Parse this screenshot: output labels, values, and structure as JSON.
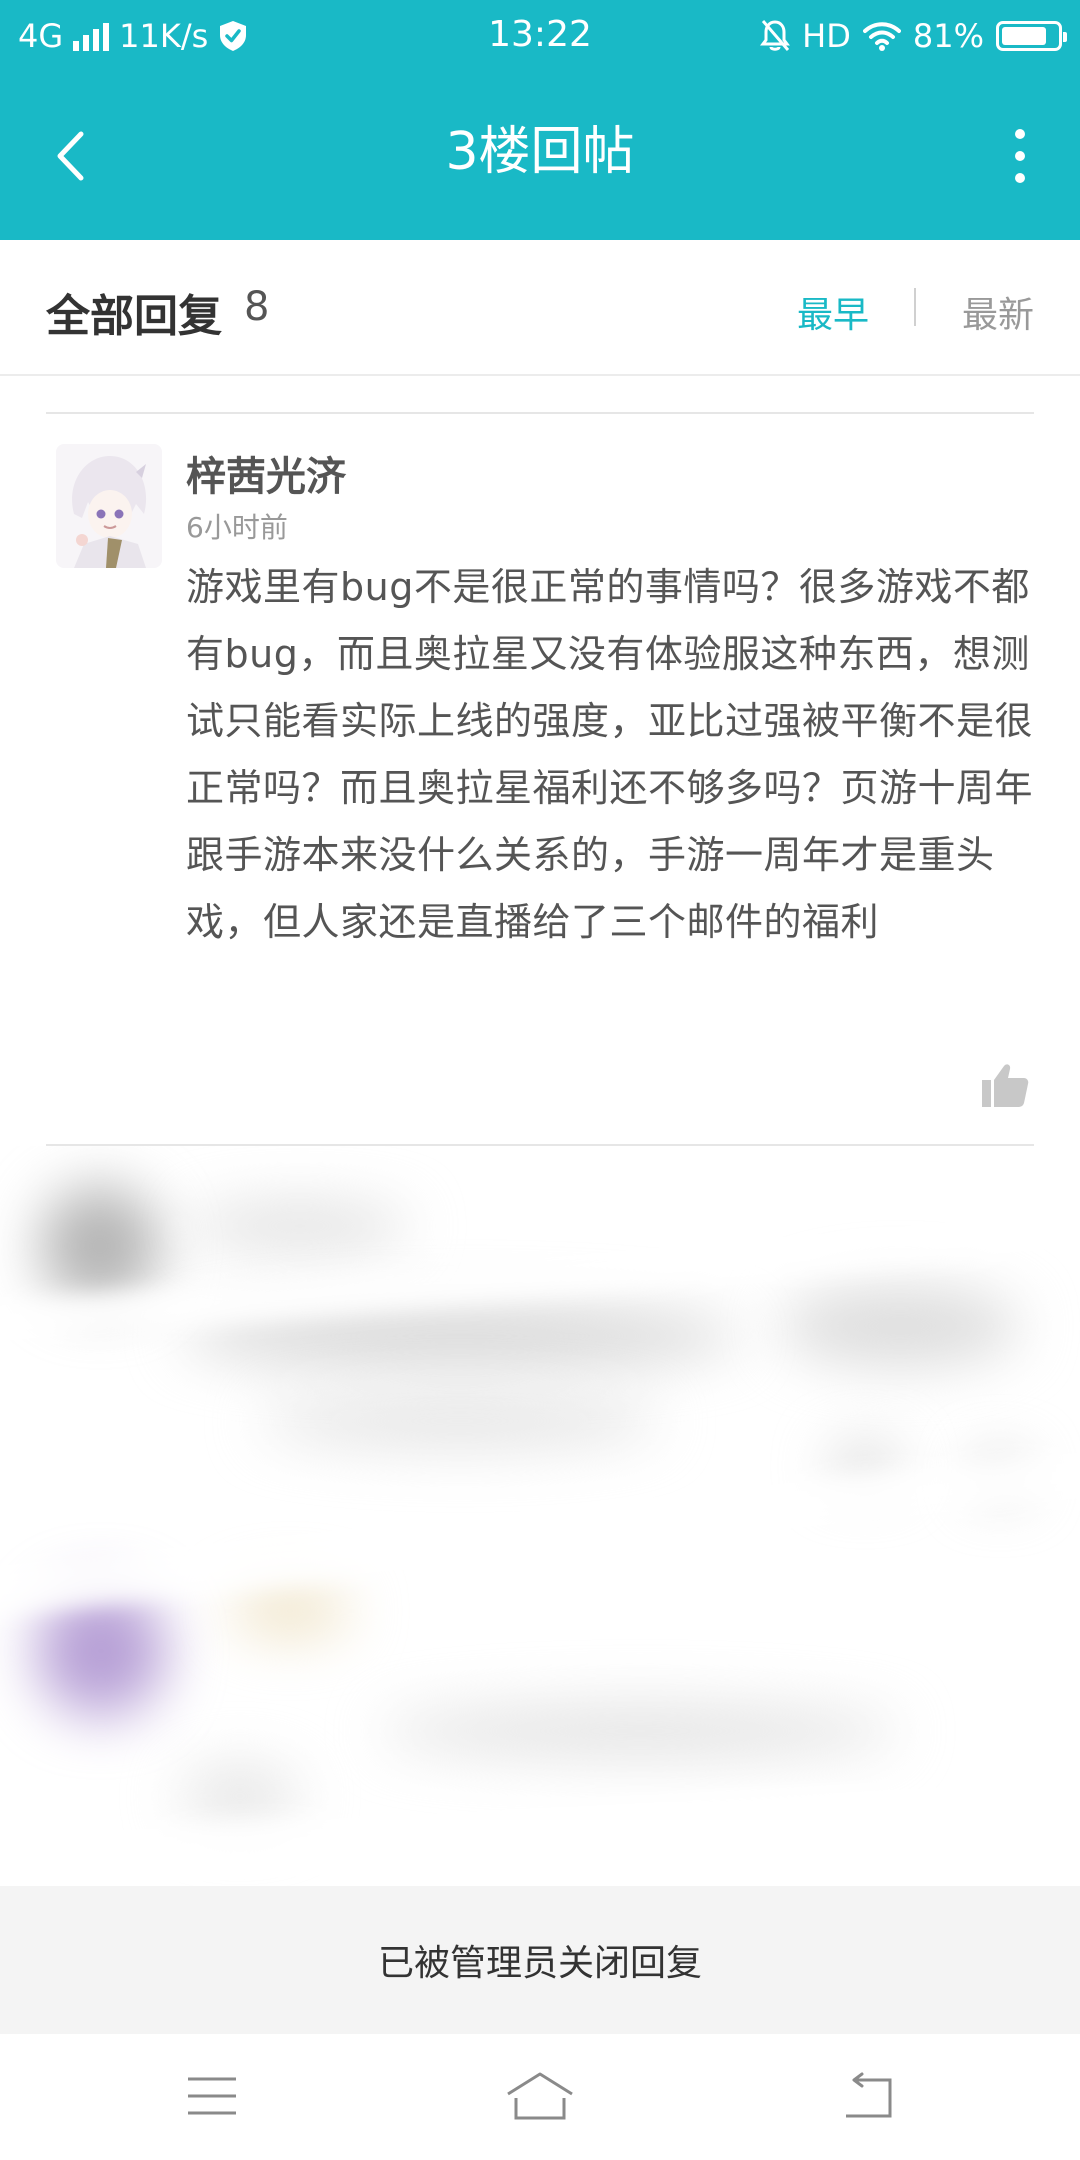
{
  "status_bar": {
    "network": "4G",
    "speed": "11K/s",
    "time": "13:22",
    "hd": "HD",
    "battery": "81%",
    "battery_level": 0.81,
    "icons": [
      "signal-icon",
      "shield-check-icon",
      "bell-off-icon",
      "wifi-icon",
      "battery-icon"
    ]
  },
  "toolbar": {
    "title": "3楼回帖",
    "back_icon": "back-arrow-icon",
    "more_icon": "more-vertical-icon"
  },
  "reply_header": {
    "label": "全部回复",
    "count": "8",
    "sort_oldest": "最早",
    "sort_newest": "最新",
    "active_sort": "最早"
  },
  "comment": {
    "username": "梓茜光济",
    "time": "6小时前",
    "text": "游戏里有bug不是很正常的事情吗？很多游戏不都有bug，而且奥拉星又没有体验服这种东西，想测试只能看实际上线的强度，亚比过强被平衡不是很正常吗？而且奥拉星福利还不够多吗？页游十周年跟手游本来没什么关系的，手游一周年才是重头戏，但人家还是直播给了三个邮件的福利",
    "like_icon": "thumbs-up-icon"
  },
  "closed_notice": "已被管理员关闭回复",
  "nav_bar": {
    "icons": [
      "menu-icon",
      "home-icon",
      "return-icon"
    ]
  },
  "colors": {
    "accent": "#19b9c6",
    "text_primary": "#333333",
    "text_secondary": "#999999"
  }
}
